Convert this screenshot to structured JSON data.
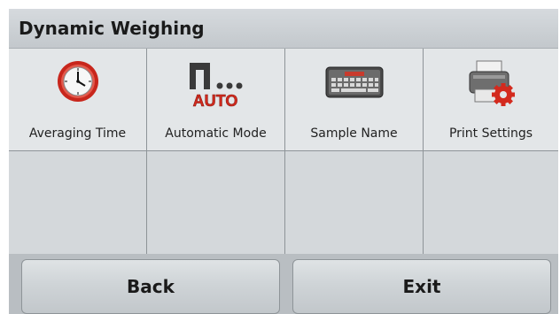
{
  "header": {
    "title": "Dynamic Weighing"
  },
  "menu": {
    "items": [
      {
        "label": "Averaging Time",
        "icon": "clock-icon"
      },
      {
        "label": "Automatic Mode",
        "icon": "auto-mode-icon",
        "icon_text": "AUTO"
      },
      {
        "label": "Sample Name",
        "icon": "keyboard-icon"
      },
      {
        "label": "Print Settings",
        "icon": "printer-settings-icon"
      }
    ]
  },
  "footer": {
    "back_label": "Back",
    "exit_label": "Exit"
  },
  "colors": {
    "accent_red": "#d32a1e",
    "title_bg": "#c9ced2",
    "cell_bg": "#e3e6e8"
  }
}
